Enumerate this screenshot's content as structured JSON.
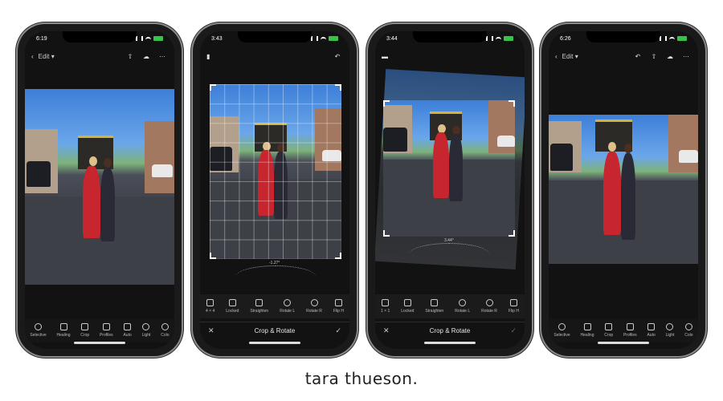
{
  "brand": "tara thueson.",
  "phones": [
    {
      "time": "6:19",
      "edit_label": "Edit",
      "tools": [
        "Selective",
        "Healing",
        "Crop",
        "Profiles",
        "Auto",
        "Light",
        "Colo"
      ]
    },
    {
      "time": "3:43",
      "dial_value": "-1.27°",
      "tools": [
        "4 × 4",
        "Locked",
        "Straighten",
        "Rotate L",
        "Rotate R",
        "Flip H"
      ],
      "crop_title": "Crop & Rotate"
    },
    {
      "time": "3:44",
      "dial_value": "3.44°",
      "tools": [
        "1 × 1",
        "Locked",
        "Straighten",
        "Rotate L",
        "Rotate R",
        "Flip H"
      ],
      "crop_title": "Crop & Rotate"
    },
    {
      "time": "6:26",
      "edit_label": "Edit",
      "tools": [
        "Selective",
        "Healing",
        "Crop",
        "Profiles",
        "Auto",
        "Light",
        "Colo"
      ]
    }
  ],
  "colors": {
    "accent": "#ffffff",
    "screen_bg": "#121212",
    "battery": "#39c24a"
  }
}
